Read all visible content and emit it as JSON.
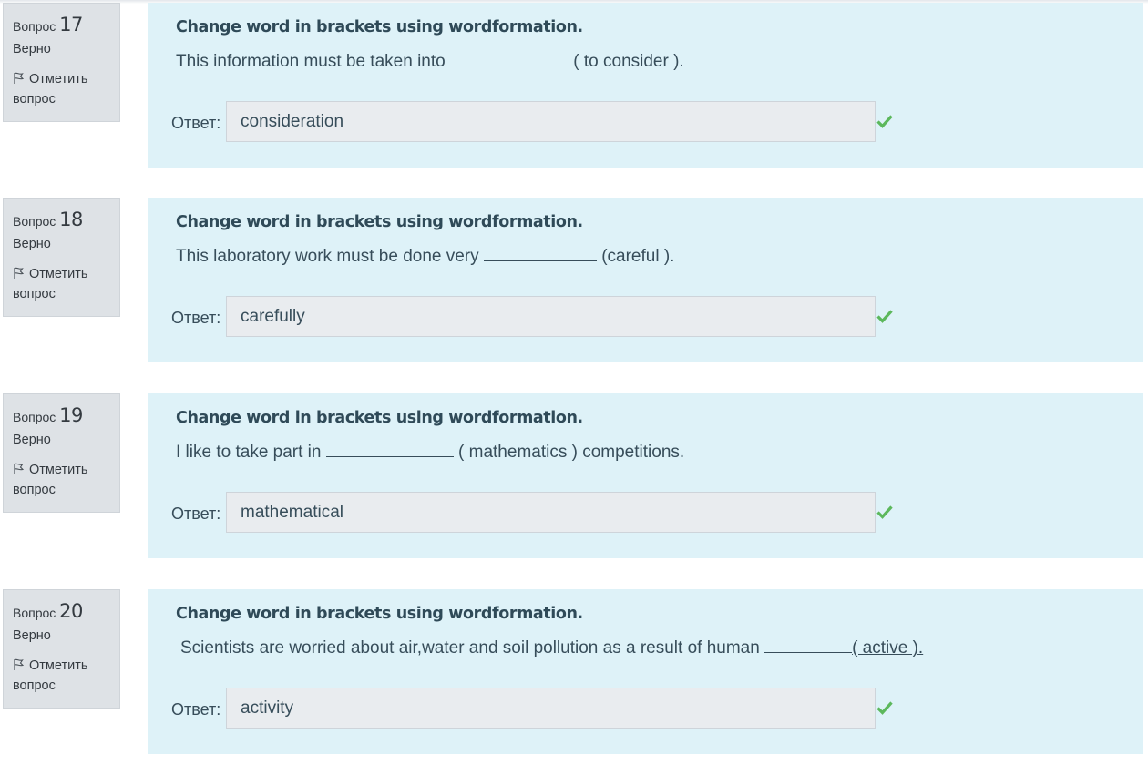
{
  "labels": {
    "question_word": "Вопрос",
    "answer_label": "Ответ:",
    "flag_label_1": "Отметить",
    "flag_label_2": "вопрос"
  },
  "colors": {
    "content_bg": "#def2f8",
    "info_bg": "#dee2e6",
    "correct_check": "#5cb85c"
  },
  "questions": [
    {
      "number": "17",
      "state": "Верно",
      "instruction": "Change word in brackets using wordformation.",
      "sentence_before": "This information must be taken into",
      "sentence_after": "( to consider ).",
      "answer": "consideration"
    },
    {
      "number": "18",
      "state": "Верно",
      "instruction": "Change word in brackets using wordformation.",
      "sentence_before": "This laboratory work must be done very",
      "sentence_after": "(careful ).",
      "answer": "carefully"
    },
    {
      "number": "19",
      "state": "Верно",
      "instruction": "Change word in brackets using wordformation.",
      "sentence_before": "I like to take part in",
      "sentence_after": "( mathematics ) competitions.",
      "answer": "mathematical"
    },
    {
      "number": "20",
      "state": "Верно",
      "instruction": "Change word in brackets using wordformation.",
      "sentence_before": "Scientists are worried about air,water and soil pollution as a result of human",
      "sentence_after": "( active ).",
      "answer": "activity"
    }
  ]
}
